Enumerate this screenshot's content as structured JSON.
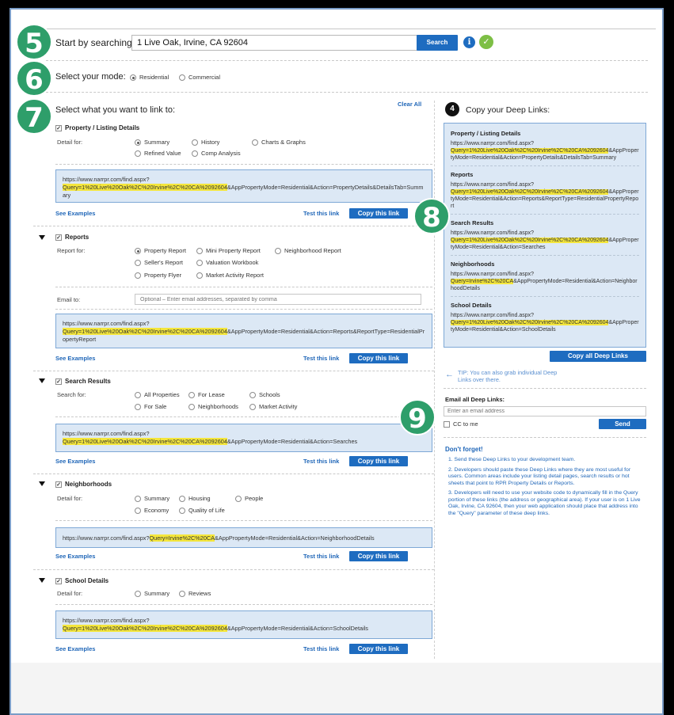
{
  "steps": {
    "s5": "5",
    "s6": "6",
    "s7": "7",
    "s8": "8",
    "s9": "9",
    "s4": "4"
  },
  "search": {
    "label": "Start by searching:",
    "value": "1 Live Oak, Irvine, CA 92604",
    "button": "Search"
  },
  "mode": {
    "label": "Select your mode:",
    "options": [
      "Residential",
      "Commercial"
    ],
    "selected": "Residential"
  },
  "link_to": {
    "title": "Select what you want to link to:",
    "clear_all": "Clear All"
  },
  "common": {
    "see_examples": "See Examples",
    "test_link": "Test this link",
    "copy_link": "Copy this link",
    "url_prefix": "https://www.narrpr.com/find.aspx?"
  },
  "property": {
    "title": "Property / Listing Details",
    "detail_label": "Detail for:",
    "options": [
      "Summary",
      "History",
      "Charts & Graphs",
      "Refined Value",
      "Comp Analysis"
    ],
    "url_hl": "Query=1%20Live%20Oak%2C%20Irvine%2C%20CA%2092604",
    "url_rest": "&AppPropertyMode=Residential&Action=PropertyDetails&DetailsTab=Summary"
  },
  "reports": {
    "title": "Reports",
    "report_label": "Report for:",
    "options": [
      "Property Report",
      "Mini Property Report",
      "Neighborhood Report",
      "Seller's Report",
      "Valuation Workbook",
      "Property Flyer",
      "Market Activity Report"
    ],
    "email_label": "Email to:",
    "email_placeholder": "Optional – Enter email addresses, separated by comma",
    "url_hl": "Query=1%20Live%20Oak%2C%20Irvine%2C%20CA%2092604",
    "url_rest": "&AppPropertyMode=Residential&Action=Reports&ReportType=ResidentialPropertyReport"
  },
  "search_results": {
    "title": "Search Results",
    "search_label": "Search for:",
    "options": [
      "All Properties",
      "For Lease",
      "Schools",
      "For Sale",
      "Neighborhoods",
      "Market Activity"
    ],
    "url_hl": "Query=1%20Live%20Oak%2C%20Irvine%2C%20CA%2092604",
    "url_rest": "&AppPropertyMode=Residential&Action=Searches"
  },
  "neighborhoods": {
    "title": "Neighborhoods",
    "detail_label": "Detail for:",
    "options": [
      "Summary",
      "Housing",
      "People",
      "Economy",
      "Quality of Life"
    ],
    "url_hl": "Query=Irvine%2C%20CA",
    "url_rest": "&AppPropertyMode=Residential&Action=NeighborhoodDetails"
  },
  "school": {
    "title": "School Details",
    "detail_label": "Detail for:",
    "options": [
      "Summary",
      "Reviews"
    ],
    "url_hl": "Query=1%20Live%20Oak%2C%20Irvine%2C%20CA%2092604",
    "url_rest": "&AppPropertyMode=Residential&Action=SchoolDetails"
  },
  "deep_links": {
    "title": "Copy your Deep Links:",
    "sections": [
      {
        "head": "Property / Listing Details",
        "hl": "Query=1%20Live%20Oak%2C%20Irvine%2C%20CA%2092604",
        "rest": "&AppPropertyMode=Residential&Action=PropertyDetails&DetailsTab=Summary"
      },
      {
        "head": "Reports",
        "hl": "Query=1%20Live%20Oak%2C%20Irvine%2C%20CA%2092604",
        "rest": "&AppPropertyMode=Residential&Action=Reports&ReportType=ResidentialPropertyReport"
      },
      {
        "head": "Search Results",
        "hl": "Query=1%20Live%20Oak%2C%20Irvine%2C%20CA%2092604",
        "rest": "&AppPropertyMode=Residential&Action=Searches"
      },
      {
        "head": "Neighborhoods",
        "hl": "Query=Irvine%2C%20CA",
        "rest": "&AppPropertyMode=Residential&Action=NeighborhoodDetails"
      },
      {
        "head": "School Details",
        "hl": "Query=1%20Live%20Oak%2C%20Irvine%2C%20CA%2092604",
        "rest": "&AppPropertyMode=Residential&Action=SchoolDetails"
      }
    ],
    "copy_all": "Copy all Deep Links",
    "tip": "TIP: You can also grab individual Deep Links over there."
  },
  "email_all": {
    "label": "Email all Deep Links:",
    "placeholder": "Enter an email address",
    "cc": "CC to me",
    "send": "Send"
  },
  "dont_forget": {
    "title": "Don't forget!",
    "items": [
      "1. Send these Deep Links to your development team.",
      "2. Developers should paste these Deep Links where they are most useful for users. Common areas include your listing detail pages, search results or hot sheets that point to RPR Property Details or Reports.",
      "3. Developers will need to use your website code to dynamically fill in the Query portion of these links (the address or geographical area). If your user is on 1 Live Oak, Irvine, CA 92604, then your web application should place that address into the \"Query\" parameter of these deep links."
    ]
  },
  "colors": {
    "accent": "#1e6cc0",
    "step": "#2e9e6a",
    "highlight": "#f4e63c",
    "linkbox": "#dce8f5"
  }
}
